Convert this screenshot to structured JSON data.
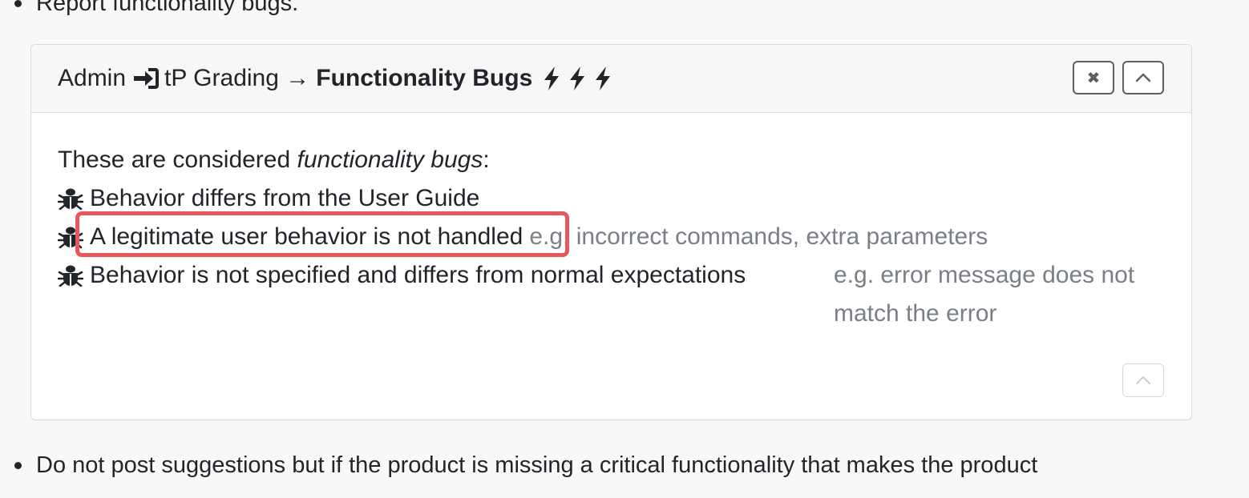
{
  "top_bullet": "Report functionality bugs.",
  "card": {
    "header": {
      "prefix": "Admin",
      "middle": "tP Grading →",
      "title": "Functionality Bugs",
      "icons": [
        "sign-in-icon",
        "bolt-icon",
        "bolt-icon",
        "bolt-icon"
      ]
    },
    "buttons": {
      "close_glyph": "✖",
      "collapse_glyph": "^"
    },
    "body": {
      "intro_text": "These are considered ",
      "intro_em": "functionality bugs",
      "intro_colon": ":",
      "items": [
        {
          "text": "Behavior differs from the User Guide",
          "note": ""
        },
        {
          "text": "A legitimate user behavior is not handled",
          "note": "e.g. incorrect commands, extra parameters"
        },
        {
          "text": "Behavior is not specified and differs from normal expectations",
          "note": "e.g. error message does not match the error"
        }
      ]
    }
  },
  "bottom_bullet": "Do not post suggestions but if the product is missing a critical functionality that makes the product",
  "colors": {
    "highlight": "#e8575a",
    "muted_text": "#7a7f85",
    "border": "#d8dbde"
  }
}
